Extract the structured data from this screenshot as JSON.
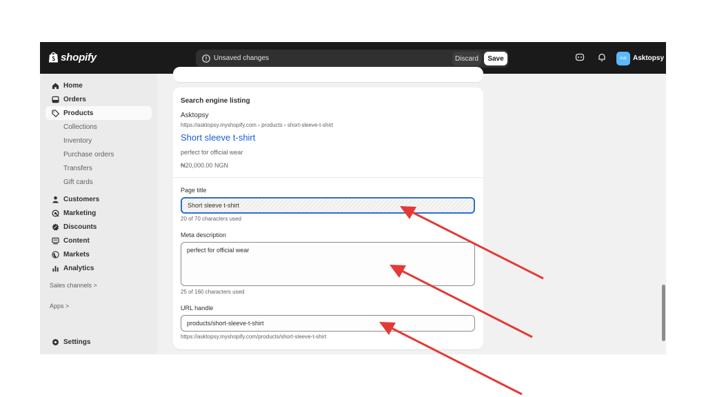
{
  "brand": {
    "wordmark": "shopify"
  },
  "topbar": {
    "unsaved_message": "Unsaved changes",
    "discard_label": "Discard",
    "save_label": "Save",
    "avatar_initials": "Ask",
    "store_name": "Asktopsy"
  },
  "sidebar": {
    "items": [
      {
        "label": "Home",
        "icon": "home-icon"
      },
      {
        "label": "Orders",
        "icon": "orders-icon"
      },
      {
        "label": "Products",
        "icon": "tag-icon",
        "active": true
      },
      {
        "label": "Collections"
      },
      {
        "label": "Inventory"
      },
      {
        "label": "Purchase orders"
      },
      {
        "label": "Transfers"
      },
      {
        "label": "Gift cards"
      },
      {
        "label": "Customers",
        "icon": "person-icon"
      },
      {
        "label": "Marketing",
        "icon": "target-icon"
      },
      {
        "label": "Discounts",
        "icon": "discount-icon"
      },
      {
        "label": "Content",
        "icon": "content-icon"
      },
      {
        "label": "Markets",
        "icon": "globe-icon"
      },
      {
        "label": "Analytics",
        "icon": "bar-chart-icon"
      }
    ],
    "sales_channels": "Sales channels >",
    "apps": "Apps >",
    "settings": "Settings"
  },
  "seo": {
    "section_title": "Search engine listing",
    "preview_store": "Asktopsy",
    "preview_url": "https://asktopsy.myshopify.com › products › short-sleeve-t-shirt",
    "preview_name": "Short sleeve t-shirt",
    "preview_description": "perfect for official wear",
    "preview_price": "₦20,000.00 NGN",
    "page_title_label": "Page title",
    "page_title_value": "Short sleeve t-shirt",
    "page_title_help": "20 of 70 characters used",
    "meta_label": "Meta description",
    "meta_value": "perfect for official wear",
    "meta_help": "25 of 160 characters used",
    "url_label": "URL handle",
    "url_value": "products/short-sleeve-t-shirt",
    "url_help": "https://asktopsy.myshopify.com/products/short-sleeve-t-shirt"
  },
  "colors": {
    "topbar": "#1a1a1a",
    "link": "#1a5ed6",
    "focus": "#2c6ecb",
    "arrow": "#e53935",
    "avatar": "#5cb8ff"
  }
}
